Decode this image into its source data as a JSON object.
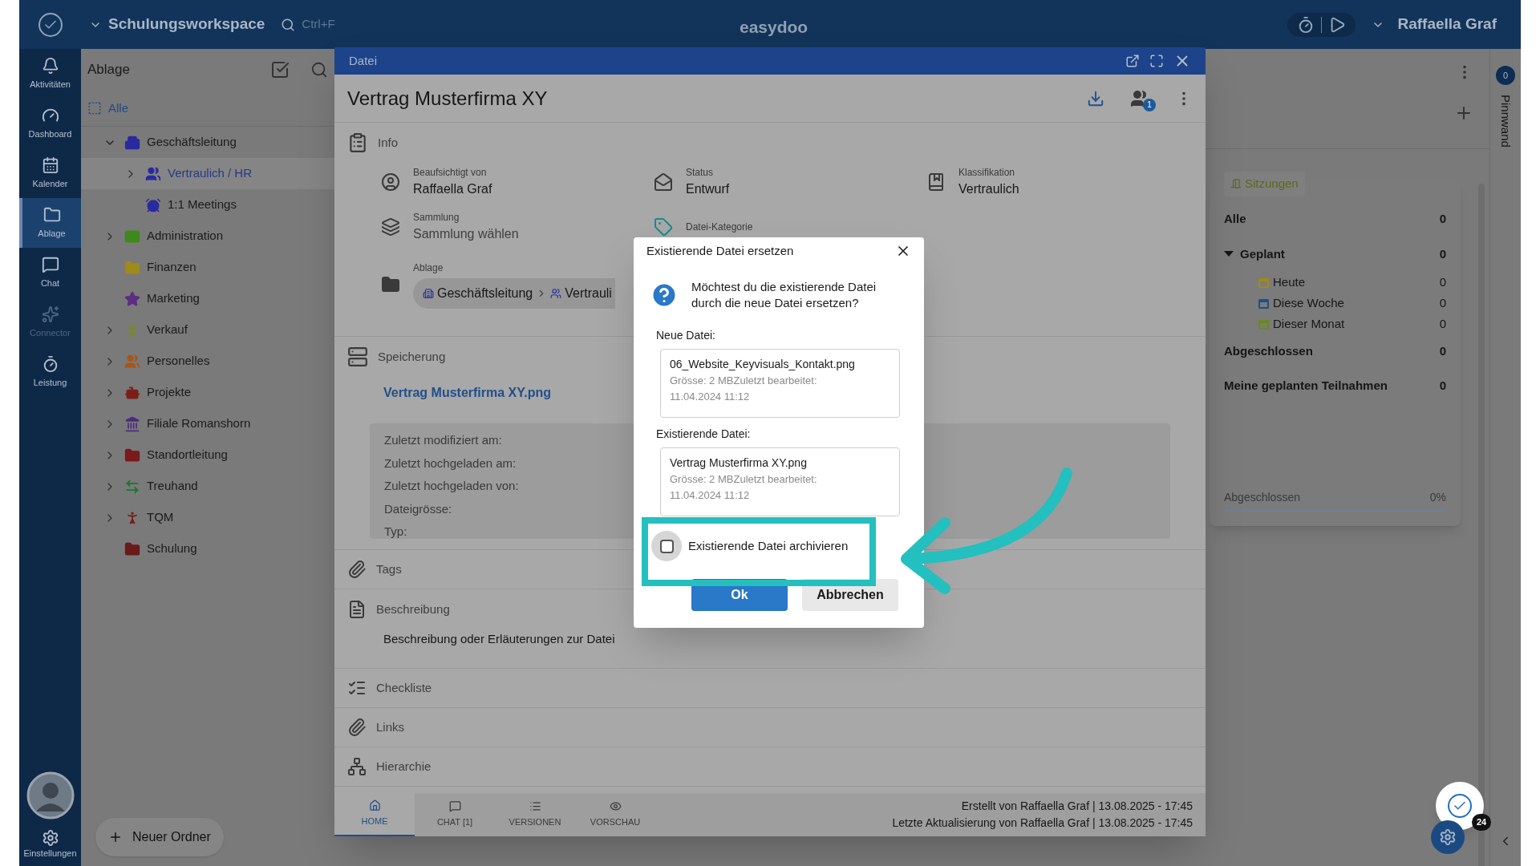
{
  "app": {
    "workspace": "Schulungsworkspace",
    "search_hint": "Ctrl+F",
    "brand": "easydoo",
    "user": "Raffaella Graf"
  },
  "nav": [
    {
      "label": "Aktivitäten",
      "kind": "bell",
      "selected": false,
      "disabled": false
    },
    {
      "label": "Dashboard",
      "kind": "gauge",
      "selected": false,
      "disabled": false
    },
    {
      "label": "Kalender",
      "kind": "calendar",
      "selected": false,
      "disabled": false
    },
    {
      "label": "Ablage",
      "kind": "folder",
      "selected": true,
      "disabled": false
    },
    {
      "label": "Chat",
      "kind": "chat",
      "selected": false,
      "disabled": false
    },
    {
      "label": "Connector",
      "kind": "sparkles",
      "selected": false,
      "disabled": true
    },
    {
      "label": "Leistung",
      "kind": "timer",
      "selected": false,
      "disabled": false
    }
  ],
  "settings_label": "Einstellungen",
  "tree": {
    "title": "Ablage",
    "all": "Alle",
    "new_folder": "Neuer Ordner",
    "items": [
      {
        "label": "Geschäftsleitung",
        "kind": "building",
        "color": "#2a2aa0",
        "expanded": true,
        "selected": false,
        "children": [
          {
            "label": "Vertraulich / HR",
            "kind": "people",
            "color": "#2a2aa0",
            "expanded": false,
            "selected": true
          },
          {
            "label": "1:1 Meetings",
            "kind": "alarm",
            "color": "#2a2aa0",
            "selected": false
          }
        ]
      },
      {
        "label": "Administration",
        "kind": "mail",
        "color": "#3d8a1a",
        "expanded": false,
        "selected": false
      },
      {
        "label": "Finanzen",
        "kind": "folder",
        "color": "#a08a1a",
        "selected": false
      },
      {
        "label": "Marketing",
        "kind": "star",
        "color": "#5a2f80",
        "selected": false
      },
      {
        "label": "Verkauf",
        "kind": "person",
        "color": "#7a8a1a",
        "expanded": false,
        "selected": false
      },
      {
        "label": "Personelles",
        "kind": "group",
        "color": "#a8561a",
        "expanded": false,
        "selected": false
      },
      {
        "label": "Projekte",
        "kind": "robot",
        "color": "#7a1f1a",
        "expanded": false,
        "selected": false
      },
      {
        "label": "Filiale Romanshorn",
        "kind": "bank",
        "color": "#4d2a80",
        "expanded": false,
        "selected": false
      },
      {
        "label": "Standortleitung",
        "kind": "folder",
        "color": "#7a1a1a",
        "expanded": false,
        "selected": false
      },
      {
        "label": "Treuhand",
        "kind": "arrows",
        "color": "#1a7a2a",
        "expanded": false,
        "selected": false
      },
      {
        "label": "TQM",
        "kind": "person",
        "color": "#7a1a1a",
        "expanded": false,
        "selected": false
      },
      {
        "label": "Schulung",
        "kind": "folder",
        "color": "#6a1a1a",
        "selected": false
      }
    ]
  },
  "window": {
    "title": "Datei",
    "file_title": "Vertrag Musterfirma XY",
    "share_badge": "1",
    "info": {
      "heading": "Info",
      "fields": [
        {
          "label": "Beaufsichtigt von",
          "value": "Raffaella Graf",
          "kind": "person",
          "placeholder": false
        },
        {
          "label": "Status",
          "value": "Entwurf",
          "kind": "envelope",
          "placeholder": false
        },
        {
          "label": "Klassifikation",
          "value": "Vertraulich",
          "kind": "book",
          "placeholder": false
        },
        {
          "label": "Sammlung",
          "value": "Sammlung wählen",
          "kind": "stack",
          "placeholder": true
        },
        {
          "label": "Datei-Kategorie",
          "kind": "tag"
        }
      ],
      "ablage": {
        "label": "Ablage",
        "crumbs": [
          "Geschäftsleitung",
          "Vertrauli"
        ]
      }
    },
    "storage": {
      "heading": "Speicherung",
      "file_link": "Vertrag Musterfirma XY.png",
      "meta": [
        "Zuletzt modifiziert am:",
        "Zuletzt hochgeladen am:",
        "Zuletzt hochgeladen von:",
        "Dateigrösse:",
        "Typ:"
      ]
    },
    "sections": [
      {
        "heading": "Tags",
        "kind": "clip"
      },
      {
        "heading": "Beschreibung",
        "kind": "doc",
        "text": "Beschreibung oder Erläuterungen zur Datei"
      },
      {
        "heading": "Checkliste",
        "kind": "check"
      },
      {
        "heading": "Links",
        "kind": "clip"
      },
      {
        "heading": "Hierarchie",
        "kind": "hier"
      }
    ],
    "tabs": [
      {
        "label": "HOME",
        "kind": "home",
        "selected": true
      },
      {
        "label": "CHAT [1]",
        "kind": "chat",
        "selected": false
      },
      {
        "label": "VERSIONEN",
        "kind": "list",
        "selected": false
      },
      {
        "label": "VORSCHAU",
        "kind": "eye",
        "selected": false
      }
    ],
    "footer": [
      "Erstellt von Raffaella Graf | 13.08.2025 - 17:45",
      "Letzte Aktualisierung von Raffaella Graf | 13.08.2025 - 17:45"
    ]
  },
  "dialog": {
    "title": "Existierende Datei ersetzen",
    "question": "Möchtest du die existierende Datei durch die neue Datei ersetzen?",
    "files": [
      {
        "label": "Neue Datei:",
        "name": "06_Website_Keyvisuals_Kontakt.png",
        "meta": "Grösse: 2 MBZuletzt bearbeitet: 11.04.2024 11:12"
      },
      {
        "label": "Existierende Datei:",
        "name": "Vertrag Musterfirma XY.png",
        "meta": "Grösse: 2 MBZuletzt bearbeitet: 11.04.2024 11:12"
      }
    ],
    "archive": {
      "label": "Existierende Datei archivieren",
      "checked": false
    },
    "buttons": [
      "Ok",
      "Abbrechen"
    ]
  },
  "sessions": {
    "tag": "Sitzungen",
    "rows": [
      {
        "label": "Alle",
        "count": "0",
        "kind": "main"
      },
      {
        "label": "Geplant",
        "count": "0",
        "kind": "group",
        "expanded": true,
        "children": [
          {
            "label": "Heute",
            "count": "0",
            "color": "#a08a1a"
          },
          {
            "label": "Diese Woche",
            "count": "0",
            "color": "#1f4f8a"
          },
          {
            "label": "Dieser Monat",
            "count": "0",
            "color": "#6a8a1a"
          }
        ]
      },
      {
        "label": "Abgeschlossen",
        "count": "0",
        "kind": "main"
      },
      {
        "label": "Meine geplanten Teilnahmen",
        "count": "0",
        "kind": "main"
      }
    ],
    "progress": {
      "label": "Abgeschlossen",
      "reading": "0%",
      "level": 0
    }
  },
  "pinboard": {
    "label": "Pinnwand",
    "count": "0"
  },
  "assistant_badge": "24"
}
